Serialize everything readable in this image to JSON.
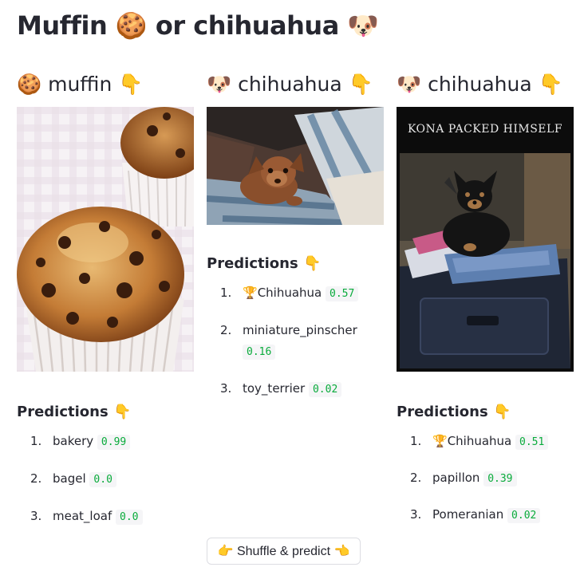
{
  "app": {
    "title": "Muffin 🍪 or chihuahua 🐶"
  },
  "columns": [
    {
      "emoji": "🍪",
      "label": "muffin",
      "pointer": "👇",
      "image_alt": "Chocolate chip muffin",
      "predictions_title": "Predictions 👇",
      "predictions": [
        {
          "num": "1.",
          "trophy": "",
          "label": "bakery",
          "score": "0.99"
        },
        {
          "num": "2.",
          "trophy": "",
          "label": "bagel",
          "score": "0.0"
        },
        {
          "num": "3.",
          "trophy": "",
          "label": "meat_loaf",
          "score": "0.0"
        }
      ]
    },
    {
      "emoji": "🐶",
      "label": "chihuahua",
      "pointer": "👇",
      "image_alt": "Chihuahua puppy on a blanket",
      "predictions_title": "Predictions 👇",
      "predictions": [
        {
          "num": "1.",
          "trophy": "🏆",
          "label": "Chihuahua",
          "score": "0.57"
        },
        {
          "num": "2.",
          "trophy": "",
          "label": "miniature_pinscher",
          "score": "0.16"
        },
        {
          "num": "3.",
          "trophy": "",
          "label": "toy_terrier",
          "score": "0.02"
        }
      ]
    },
    {
      "emoji": "🐶",
      "label": "chihuahua",
      "pointer": "👇",
      "image_alt": "Chihuahua sitting on a packed suitcase",
      "image_caption": "KONA PACKED HIMSELF",
      "predictions_title": "Predictions 👇",
      "predictions": [
        {
          "num": "1.",
          "trophy": "🏆",
          "label": "Chihuahua",
          "score": "0.51"
        },
        {
          "num": "2.",
          "trophy": "",
          "label": "papillon",
          "score": "0.39"
        },
        {
          "num": "3.",
          "trophy": "",
          "label": "Pomeranian",
          "score": "0.02"
        }
      ]
    }
  ],
  "shuffle_button": {
    "label": "👉 Shuffle & predict 👈"
  }
}
